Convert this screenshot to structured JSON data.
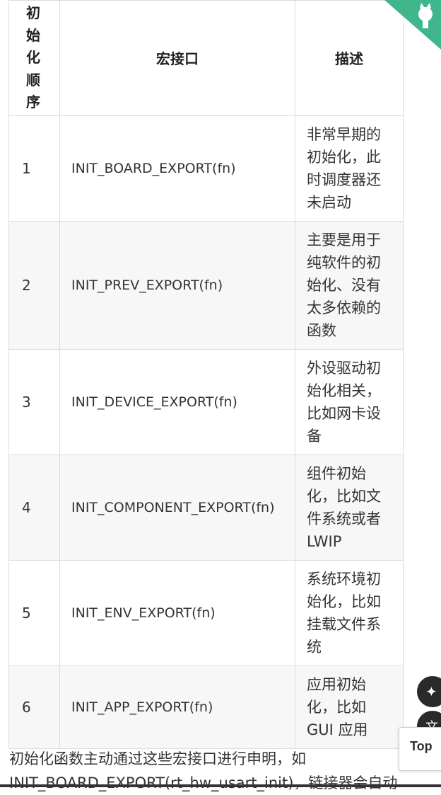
{
  "table": {
    "headers": [
      "初\n始\n化\n顺\n序",
      "宏接口",
      "描述"
    ],
    "rows": [
      {
        "order": "1",
        "macro": "INIT_BOARD_EXPORT(fn)",
        "desc": "非常早期的初始化，此时调度器还未启动"
      },
      {
        "order": "2",
        "macro": "INIT_PREV_EXPORT(fn)",
        "desc": "主要是用于纯软件的初始化、没有太多依赖的函数"
      },
      {
        "order": "3",
        "macro": "INIT_DEVICE_EXPORT(fn)",
        "desc": "外设驱动初始化相关，比如网卡设备"
      },
      {
        "order": "4",
        "macro": "INIT_COMPONENT_EXPORT(fn)",
        "desc": "组件初始化，比如文件系统或者 LWIP"
      },
      {
        "order": "5",
        "macro": "INIT_ENV_EXPORT(fn)",
        "desc": "系统环境初始化，比如挂载文件系统"
      },
      {
        "order": "6",
        "macro": "INIT_APP_EXPORT(fn)",
        "desc": "应用初始化，比如 GUI 应用"
      }
    ]
  },
  "paragraph": {
    "line1": "初始化函数主动通过这些宏接口进行申明，如",
    "line2": "INIT_BOARD_EXPORT(rt_hw_usart_init)，链接器会自动"
  },
  "floating": {
    "top_label": "Top",
    "ai_icon": "sparkle-icon",
    "translate_icon": "translate-icon",
    "corner_icon": "github-octocat-icon"
  },
  "colors": {
    "corner_banner": "#3fb68b",
    "fab_bg": "#2a2a2a",
    "stripe": "#f7f7f7"
  }
}
